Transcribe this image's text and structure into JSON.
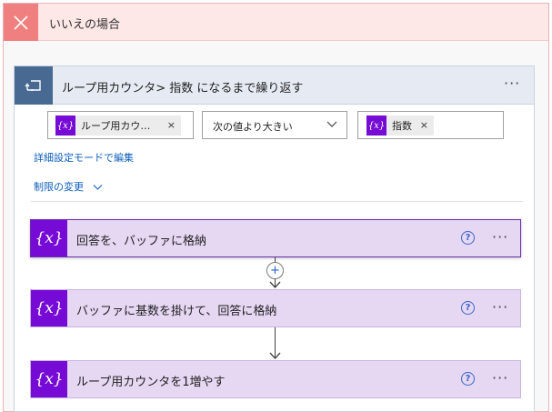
{
  "no_branch": {
    "title": "いいえの場合",
    "close_icon": "close-icon"
  },
  "until": {
    "title": "ループ用カウンタ> 指数 になるまで繰り返す",
    "icon": "do-until-loop-icon",
    "more": "···",
    "condition": {
      "left_token": "ループ用カウ…",
      "operator": "次の値より大きい",
      "right_token": "指数",
      "token_icon": "{x}",
      "remove": "×"
    },
    "advanced_link": "詳細設定モードで編集",
    "limits_link": "制限の変更"
  },
  "actions": [
    {
      "title": "回答を、バッファに格納",
      "icon": "{x}",
      "help": "?",
      "more": "···"
    },
    {
      "title": "バッファに基数を掛けて、回答に格納",
      "icon": "{x}",
      "help": "?",
      "more": "···"
    },
    {
      "title": "ループ用カウンタを1増やす",
      "icon": "{x}",
      "help": "?",
      "more": "···"
    }
  ],
  "add_step": "+",
  "colors": {
    "no_header_bg": "#fde7e7",
    "no_icon_bg": "#f08080",
    "loop_header_bg": "#e6ebf3",
    "loop_icon_bg": "#486991",
    "variable_purple": "#770bd6",
    "action_bg": "#e6d7f3",
    "link_blue": "#0f5fbe"
  }
}
